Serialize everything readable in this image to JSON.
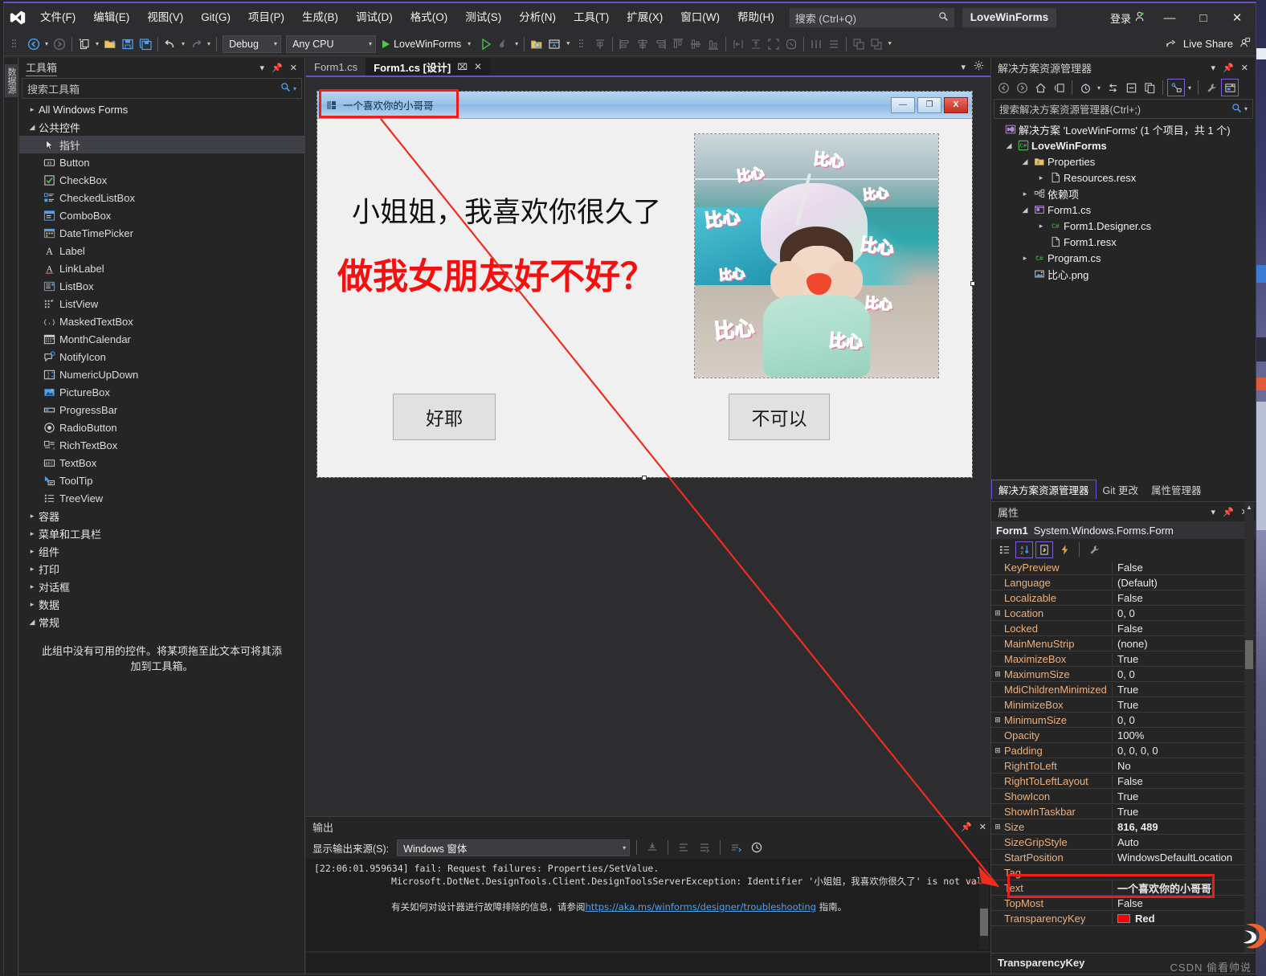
{
  "app": {
    "title_badge": "LoveWinForms",
    "signin": "登录",
    "live_share": "Live Share"
  },
  "menu": {
    "items": [
      "文件(F)",
      "编辑(E)",
      "视图(V)",
      "Git(G)",
      "项目(P)",
      "生成(B)",
      "调试(D)",
      "格式(O)",
      "测试(S)",
      "分析(N)",
      "工具(T)",
      "扩展(X)",
      "窗口(W)",
      "帮助(H)"
    ],
    "search_placeholder": "搜索 (Ctrl+Q)"
  },
  "toolbar": {
    "config": "Debug",
    "platform": "Any CPU",
    "run_target": "LoveWinForms"
  },
  "toolbox": {
    "title": "工具箱",
    "search_placeholder": "搜索工具箱",
    "groups": [
      {
        "label": "All Windows Forms",
        "expanded": false
      },
      {
        "label": "公共控件",
        "expanded": true
      }
    ],
    "items": [
      {
        "label": "指针",
        "icon": "pointer-icon",
        "selected": true
      },
      {
        "label": "Button",
        "icon": "button-icon"
      },
      {
        "label": "CheckBox",
        "icon": "checkbox-icon"
      },
      {
        "label": "CheckedListBox",
        "icon": "checkedlistbox-icon"
      },
      {
        "label": "ComboBox",
        "icon": "combobox-icon"
      },
      {
        "label": "DateTimePicker",
        "icon": "datetimepicker-icon"
      },
      {
        "label": "Label",
        "icon": "label-icon"
      },
      {
        "label": "LinkLabel",
        "icon": "linklabel-icon"
      },
      {
        "label": "ListBox",
        "icon": "listbox-icon"
      },
      {
        "label": "ListView",
        "icon": "listview-icon"
      },
      {
        "label": "MaskedTextBox",
        "icon": "maskedtextbox-icon"
      },
      {
        "label": "MonthCalendar",
        "icon": "monthcalendar-icon"
      },
      {
        "label": "NotifyIcon",
        "icon": "notifyicon-icon"
      },
      {
        "label": "NumericUpDown",
        "icon": "numericupdown-icon"
      },
      {
        "label": "PictureBox",
        "icon": "picturebox-icon"
      },
      {
        "label": "ProgressBar",
        "icon": "progressbar-icon"
      },
      {
        "label": "RadioButton",
        "icon": "radiobutton-icon"
      },
      {
        "label": "RichTextBox",
        "icon": "richtextbox-icon"
      },
      {
        "label": "TextBox",
        "icon": "textbox-icon"
      },
      {
        "label": "ToolTip",
        "icon": "tooltip-icon"
      },
      {
        "label": "TreeView",
        "icon": "treeview-icon"
      }
    ],
    "collapsed_groups": [
      "容器",
      "菜单和工具栏",
      "组件",
      "打印",
      "对话框",
      "数据"
    ],
    "last_group": "常规",
    "empty_note": "此组中没有可用的控件。将某项拖至此文本可将其添加到工具箱。"
  },
  "dock_tab_left": "数据源",
  "editor": {
    "tabs": [
      {
        "label": "Form1.cs",
        "active": false
      },
      {
        "label": "Form1.cs [设计]",
        "active": true
      }
    ],
    "close_glyph": "✕",
    "pin_glyph": "⚲"
  },
  "form": {
    "title": "一个喜欢你的小哥哥",
    "minimize": "—",
    "maximize": "❐",
    "close": "X",
    "label_top": "小姐姐，我喜欢你很久了",
    "label_question": "做我女朋友好不好？",
    "button_yes": "好耶",
    "button_no": "不可以",
    "picture_overlay_text": "比心"
  },
  "output": {
    "title": "输出",
    "source_label": "显示输出来源(S):",
    "source_value": "Windows 窗体",
    "lines": [
      "[22:06:01.959634] fail: Request failures: Properties/SetValue.",
      "Microsoft.DotNet.DesignTools.Client.DesignToolsServerException: Identifier '小姐姐，我喜欢你很久了' is not valid."
    ],
    "help_prefix": "有关如何对设计器进行故障排除的信息，请参阅 ",
    "help_link": "https://aka.ms/winforms/designer/troubleshooting",
    "help_suffix": " 指南。"
  },
  "solution_explorer": {
    "title": "解决方案资源管理器",
    "search_placeholder": "搜索解决方案资源管理器(Ctrl+;)",
    "root": "解决方案 'LoveWinForms' (1 个项目，共 1 个)",
    "nodes": [
      {
        "label": "LoveWinForms",
        "indent": 1,
        "expander": "▴",
        "icon": "csharp-project-icon",
        "bold": true
      },
      {
        "label": "Properties",
        "indent": 2,
        "expander": "▴",
        "icon": "properties-folder-icon"
      },
      {
        "label": "Resources.resx",
        "indent": 3,
        "expander": "▸",
        "icon": "resx-file-icon"
      },
      {
        "label": "依赖项",
        "indent": 2,
        "expander": "▸",
        "icon": "dependencies-icon"
      },
      {
        "label": "Form1.cs",
        "indent": 2,
        "expander": "▴",
        "icon": "form-file-icon"
      },
      {
        "label": "Form1.Designer.cs",
        "indent": 3,
        "expander": "▸",
        "icon": "csharp-file-icon"
      },
      {
        "label": "Form1.resx",
        "indent": 3,
        "expander": "",
        "icon": "resx-file-icon"
      },
      {
        "label": "Program.cs",
        "indent": 2,
        "expander": "▸",
        "icon": "csharp-file-icon"
      },
      {
        "label": "比心.png",
        "indent": 2,
        "expander": "",
        "icon": "image-file-icon"
      }
    ]
  },
  "bottom_tabs": [
    {
      "label": "解决方案资源管理器",
      "active": true
    },
    {
      "label": "Git 更改",
      "active": false
    },
    {
      "label": "属性管理器",
      "active": false
    }
  ],
  "properties": {
    "title": "属性",
    "object_name": "Form1",
    "object_type": "System.Windows.Forms.Form",
    "rows": [
      {
        "name": "KeyPreview",
        "value": "False",
        "expandable": false
      },
      {
        "name": "Language",
        "value": "(Default)",
        "expandable": false
      },
      {
        "name": "Localizable",
        "value": "False",
        "expandable": false
      },
      {
        "name": "Location",
        "value": "0, 0",
        "expandable": true
      },
      {
        "name": "Locked",
        "value": "False",
        "expandable": false
      },
      {
        "name": "MainMenuStrip",
        "value": "(none)",
        "expandable": false
      },
      {
        "name": "MaximizeBox",
        "value": "True",
        "expandable": false
      },
      {
        "name": "MaximumSize",
        "value": "0, 0",
        "expandable": true
      },
      {
        "name": "MdiChildrenMinimized",
        "value": "True",
        "expandable": false
      },
      {
        "name": "MinimizeBox",
        "value": "True",
        "expandable": false
      },
      {
        "name": "MinimumSize",
        "value": "0, 0",
        "expandable": true
      },
      {
        "name": "Opacity",
        "value": "100%",
        "expandable": false
      },
      {
        "name": "Padding",
        "value": "0, 0, 0, 0",
        "expandable": true
      },
      {
        "name": "RightToLeft",
        "value": "No",
        "expandable": false
      },
      {
        "name": "RightToLeftLayout",
        "value": "False",
        "expandable": false
      },
      {
        "name": "ShowIcon",
        "value": "True",
        "expandable": false
      },
      {
        "name": "ShowInTaskbar",
        "value": "True",
        "expandable": false
      },
      {
        "name": "Size",
        "value": "816, 489",
        "expandable": true,
        "bold": true
      },
      {
        "name": "SizeGripStyle",
        "value": "Auto",
        "expandable": false
      },
      {
        "name": "StartPosition",
        "value": "WindowsDefaultLocation",
        "expandable": false
      },
      {
        "name": "Tag",
        "value": "",
        "expandable": false
      },
      {
        "name": "Text",
        "value": "一个喜欢你的小哥哥",
        "expandable": false,
        "highlight": true
      },
      {
        "name": "TopMost",
        "value": "False",
        "expandable": false
      },
      {
        "name": "TransparencyKey",
        "value": "Red",
        "expandable": false,
        "swatch": "#ff0000",
        "bold": true
      }
    ],
    "footer": "TransparencyKey"
  },
  "watermark": "CSDN 偷看帅说",
  "colors": {
    "accent": "#6a4fcf",
    "error_red": "#ef1c1c",
    "chrome": "#2d2d30",
    "panel": "#252526",
    "prop_name": "#efb07a",
    "link": "#4ea1f0",
    "transparency_key": "#ff0000"
  }
}
